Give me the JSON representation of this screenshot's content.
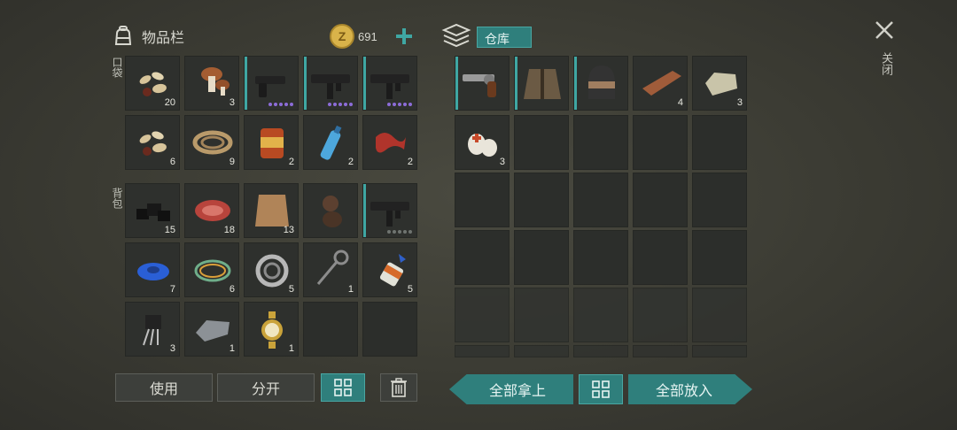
{
  "inventory": {
    "title": "物品栏",
    "coins": "691",
    "pocket_label": "口袋",
    "backpack_label": "背包"
  },
  "storage": {
    "title": "仓库"
  },
  "close": {
    "label": "关闭"
  },
  "buttons": {
    "use": "使用",
    "split": "分开",
    "take_all": "全部拿上",
    "put_all": "全部放入"
  },
  "pocket_items": [
    {
      "name": "seeds",
      "count": "20"
    },
    {
      "name": "mushrooms",
      "count": "3"
    },
    {
      "name": "pistol",
      "count": ""
    },
    {
      "name": "smg",
      "count": ""
    },
    {
      "name": "smg",
      "count": ""
    },
    {
      "name": "seeds",
      "count": "6"
    },
    {
      "name": "rope",
      "count": "9"
    },
    {
      "name": "canned-food",
      "count": "2"
    },
    {
      "name": "water-bottle",
      "count": "2"
    },
    {
      "name": "raw-bacon",
      "count": "2"
    }
  ],
  "backpack_items": [
    {
      "name": "coal",
      "count": "15"
    },
    {
      "name": "steak",
      "count": "18"
    },
    {
      "name": "leather",
      "count": "13"
    },
    {
      "name": "puppy",
      "count": ""
    },
    {
      "name": "smg",
      "count": ""
    },
    {
      "name": "tape",
      "count": "7"
    },
    {
      "name": "wire",
      "count": "6"
    },
    {
      "name": "bearing",
      "count": "5"
    },
    {
      "name": "key",
      "count": "1"
    },
    {
      "name": "glue",
      "count": "5"
    },
    {
      "name": "transistor",
      "count": "3"
    },
    {
      "name": "metal-ingot",
      "count": "1"
    },
    {
      "name": "watch",
      "count": "1"
    }
  ],
  "storage_items": [
    {
      "name": "revolver",
      "count": ""
    },
    {
      "name": "jacket",
      "count": ""
    },
    {
      "name": "helmet",
      "count": ""
    },
    {
      "name": "wood-plank",
      "count": "4"
    },
    {
      "name": "stone",
      "count": "3"
    },
    {
      "name": "bandage",
      "count": "3"
    }
  ],
  "colors": {
    "accent": "#3fa7a3",
    "gold": "#d9b34a",
    "rarity": "#8c6cd8"
  }
}
